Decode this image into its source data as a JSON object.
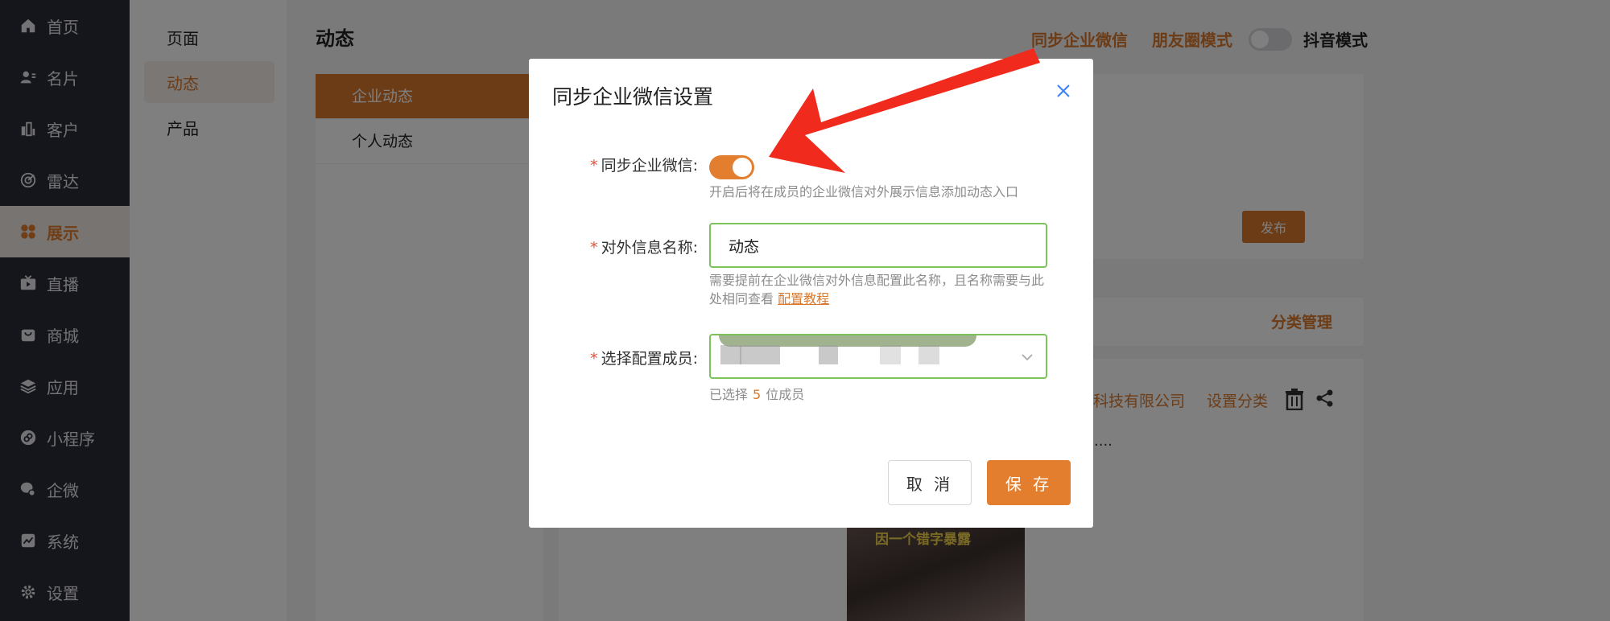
{
  "nav": {
    "items": [
      {
        "label": "首页",
        "icon": "home-icon"
      },
      {
        "label": "名片",
        "icon": "card-icon"
      },
      {
        "label": "客户",
        "icon": "customers-icon"
      },
      {
        "label": "雷达",
        "icon": "radar-icon"
      },
      {
        "label": "展示",
        "icon": "grid-icon"
      },
      {
        "label": "直播",
        "icon": "live-icon"
      },
      {
        "label": "商城",
        "icon": "shop-icon"
      },
      {
        "label": "应用",
        "icon": "layers-icon"
      },
      {
        "label": "小程序",
        "icon": "miniprogram-icon"
      },
      {
        "label": "企微",
        "icon": "wecom-icon"
      },
      {
        "label": "系统",
        "icon": "system-icon"
      },
      {
        "label": "设置",
        "icon": "gear-icon"
      }
    ],
    "active_index": 4
  },
  "submenu": {
    "items": [
      "页面",
      "动态",
      "产品"
    ],
    "active_index": 1
  },
  "main": {
    "title": "动态",
    "links": {
      "sync_wecom": "同步企业微信",
      "moments_mode": "朋友圈模式",
      "douyin_mode": "抖音模式"
    },
    "categories": [
      "企业动态",
      "个人动态"
    ],
    "publish_label": "发布",
    "category_manage": "分类管理",
    "company_name": "科技有限公司",
    "set_category": "设置分类",
    "ellipsis": "....",
    "video_caption": "因一个错字暴露"
  },
  "modal": {
    "title": "同步企业微信设置",
    "fields": {
      "sync_label": "同步企业微信:",
      "sync_enabled": true,
      "sync_hint": "开启后将在成员的企业微信对外展示信息添加动态入口",
      "name_label": "对外信息名称:",
      "name_value": "动态",
      "name_hint": "需要提前在企业微信对外信息配置此名称，且名称需要与此处相同查看",
      "name_hint_link": "配置教程",
      "members_label": "选择配置成员:",
      "picked_prefix": "已选择",
      "picked_count": "5",
      "picked_suffix": "位成员"
    },
    "cancel_label": "取 消",
    "save_label": "保 存"
  },
  "colors": {
    "accent": "#e27e2e",
    "nav_bg": "#2a2c36",
    "input_border": "#7dc35b",
    "arrow": "#f02a1c"
  }
}
